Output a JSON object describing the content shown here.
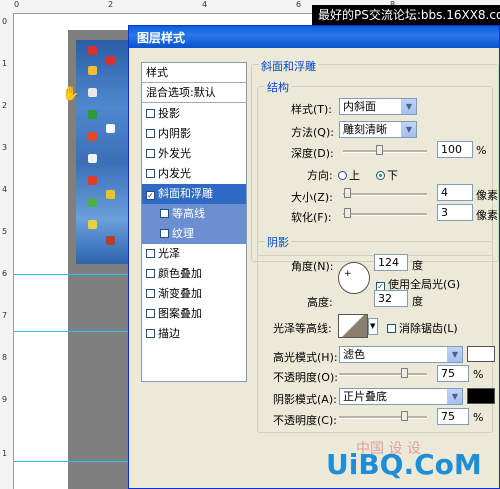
{
  "watermark_top": "最好的PS交流论坛:bbs.16XX8.com",
  "watermark_bottom": "UiBQ.CoM",
  "watermark_bottom_cn": "中国 设 设",
  "rulers": {
    "top_numbers": [
      "0",
      "2",
      "4",
      "6",
      "8"
    ],
    "left_numbers": [
      "0",
      "1",
      "2",
      "3",
      "4",
      "5",
      "6",
      "7",
      "8",
      "9",
      "1"
    ]
  },
  "dialog": {
    "title": "图层样式",
    "styles_header": "样式",
    "blend_options": "混合选项:默认",
    "effects": [
      {
        "label": "投影",
        "checked": false
      },
      {
        "label": "内阴影",
        "checked": false
      },
      {
        "label": "外发光",
        "checked": false
      },
      {
        "label": "内发光",
        "checked": false
      },
      {
        "label": "斜面和浮雕",
        "checked": true,
        "selected": true
      },
      {
        "label": "等高线",
        "checked": false,
        "sub": true
      },
      {
        "label": "纹理",
        "checked": false,
        "sub": true
      },
      {
        "label": "光泽",
        "checked": false
      },
      {
        "label": "颜色叠加",
        "checked": false
      },
      {
        "label": "渐变叠加",
        "checked": false
      },
      {
        "label": "图案叠加",
        "checked": false
      },
      {
        "label": "描边",
        "checked": false
      }
    ],
    "bevel": {
      "group_title": "斜面和浮雕",
      "structure_title": "结构",
      "style_label": "样式(T):",
      "style_value": "内斜面",
      "technique_label": "方法(Q):",
      "technique_value": "雕刻清晰",
      "depth_label": "深度(D):",
      "depth_value": "100",
      "depth_unit": "%",
      "direction_label": "方向:",
      "direction_up": "上",
      "direction_down": "下",
      "size_label": "大小(Z):",
      "size_value": "4",
      "size_unit": "像素",
      "soften_label": "软化(F):",
      "soften_value": "3",
      "soften_unit": "像素"
    },
    "shading": {
      "title": "阴影",
      "angle_label": "角度(N):",
      "angle_value": "124",
      "angle_unit": "度",
      "global_light_label": "使用全局光(G)",
      "altitude_label": "高度:",
      "altitude_value": "32",
      "altitude_unit": "度",
      "gloss_label": "光泽等高线:",
      "antialias_label": "消除锯齿(L)",
      "highlight_mode_label": "高光模式(H):",
      "highlight_mode_value": "滤色",
      "highlight_color": "#ffffff",
      "highlight_opacity_label": "不透明度(O):",
      "highlight_opacity_value": "75",
      "shadow_mode_label": "阴影模式(A):",
      "shadow_mode_value": "正片叠底",
      "shadow_color": "#000000",
      "shadow_opacity_label": "不透明度(C):",
      "shadow_opacity_value": "75",
      "percent": "%"
    }
  }
}
